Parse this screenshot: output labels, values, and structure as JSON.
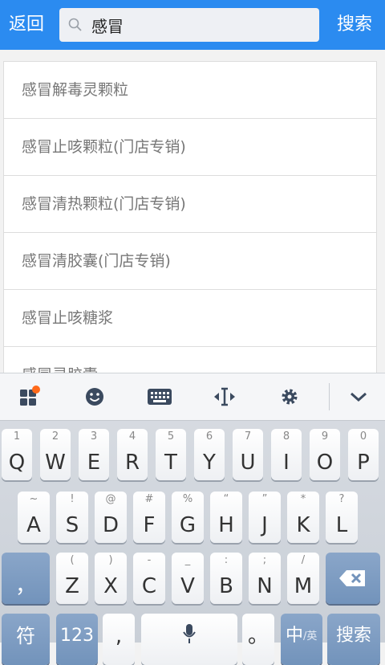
{
  "header": {
    "back_label": "返回",
    "search_value": "感冒",
    "search_label": "搜索"
  },
  "suggestions": [
    "感冒解毒灵颗粒",
    "感冒止咳颗粒(门店专销)",
    "感冒清热颗粒(门店专销)",
    "感冒清胶囊(门店专销)",
    "感冒止咳糖浆",
    "感冒灵胶囊"
  ],
  "keyboard": {
    "toolbar": [
      "apps-icon",
      "emoji-icon",
      "keyboard-icon",
      "cursor-icon",
      "settings-icon",
      "collapse-icon"
    ],
    "row1": [
      [
        "Q",
        "1"
      ],
      [
        "W",
        "2"
      ],
      [
        "E",
        "3"
      ],
      [
        "R",
        "4"
      ],
      [
        "T",
        "5"
      ],
      [
        "Y",
        "6"
      ],
      [
        "U",
        "7"
      ],
      [
        "I",
        "8"
      ],
      [
        "O",
        "9"
      ],
      [
        "P",
        "0"
      ]
    ],
    "row2": [
      [
        "A",
        "~"
      ],
      [
        "S",
        "!"
      ],
      [
        "D",
        "@"
      ],
      [
        "F",
        "#"
      ],
      [
        "G",
        "%"
      ],
      [
        "H",
        "“"
      ],
      [
        "J",
        "”"
      ],
      [
        "K",
        "*"
      ],
      [
        "L",
        "?"
      ]
    ],
    "row3": [
      [
        "Z",
        "("
      ],
      [
        "X",
        ")"
      ],
      [
        "C",
        "-"
      ],
      [
        "V",
        "_"
      ],
      [
        "B",
        ":"
      ],
      [
        "N",
        ";"
      ],
      [
        "M",
        "/"
      ]
    ],
    "comma_label": "，",
    "fu_label": "符",
    "num_label": "123",
    "comma2_label": ",",
    "period_label": "。",
    "lang_label": "中",
    "lang_sub": "/英",
    "search_label": "搜索"
  },
  "accent_color": "#2b8bf0"
}
